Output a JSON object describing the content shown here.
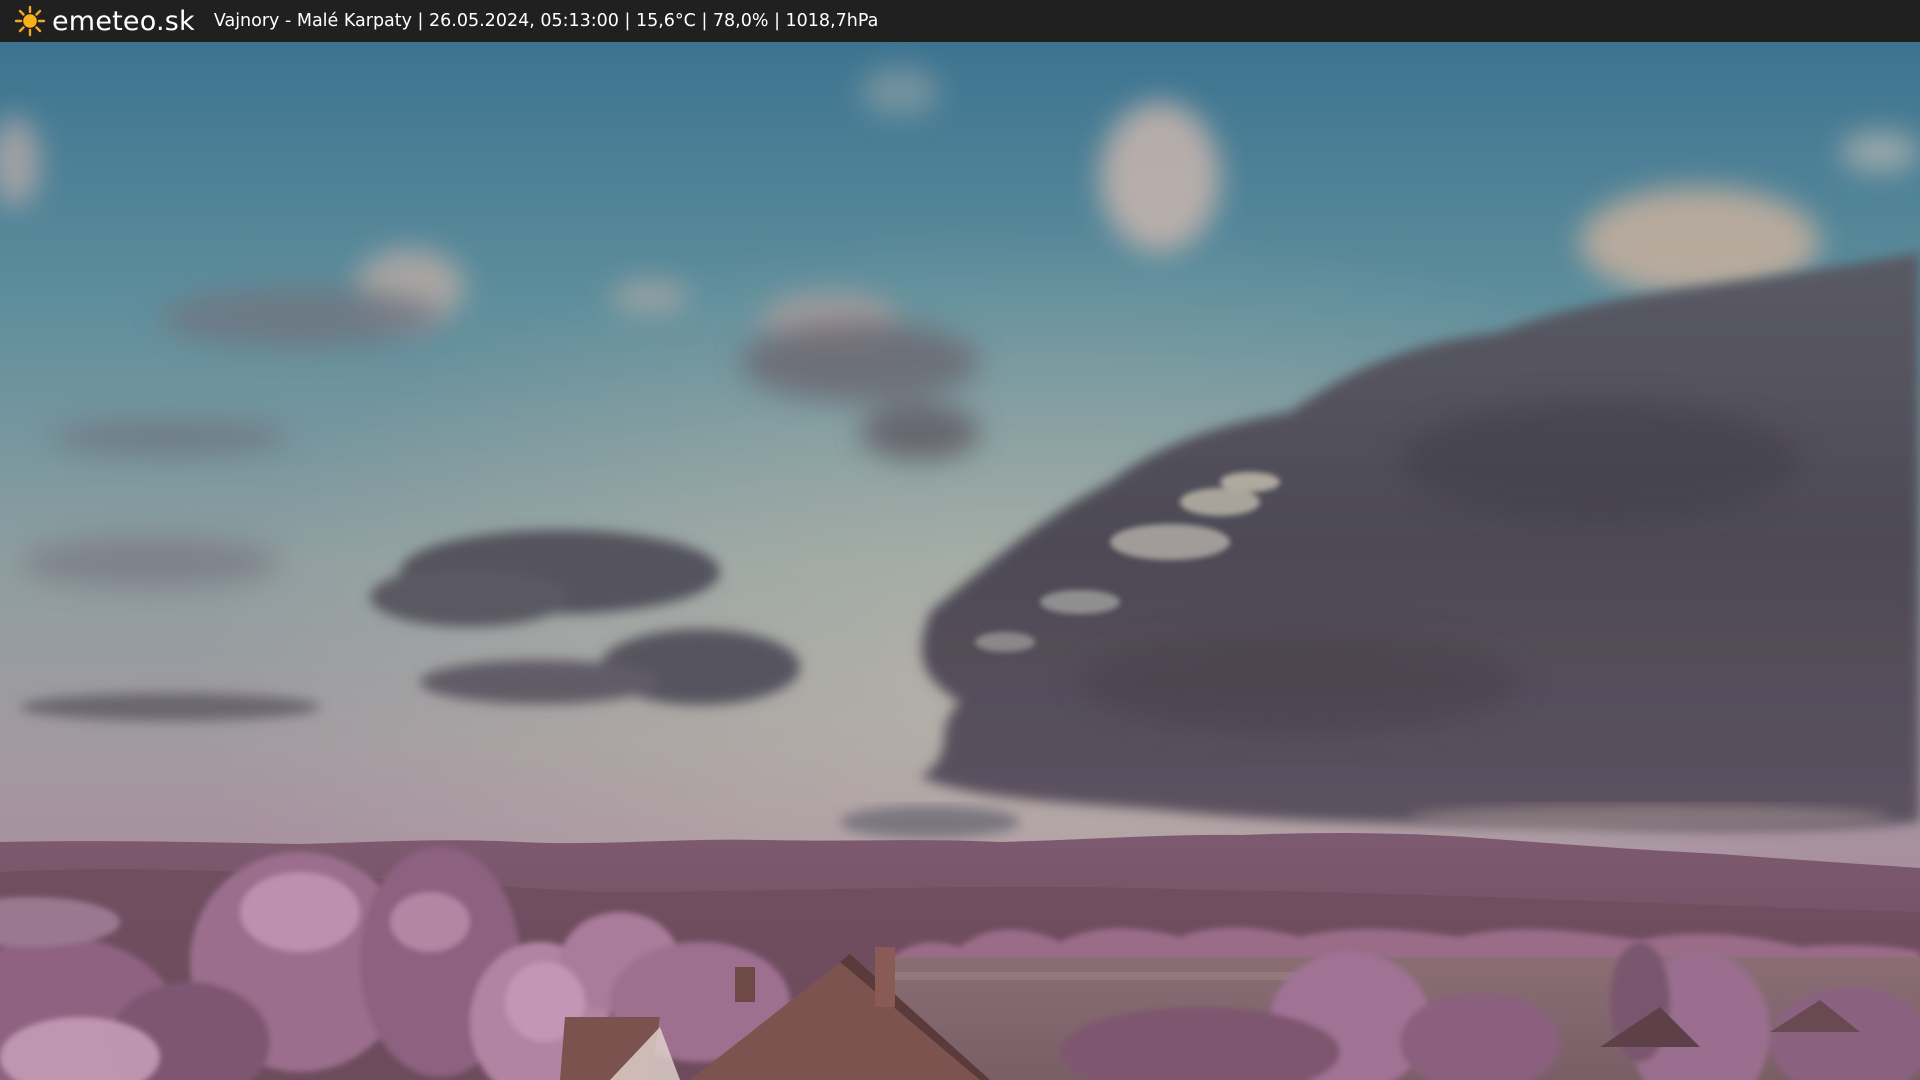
{
  "header": {
    "brand": "emeteo.sk",
    "brand_icon": "sun-icon",
    "station_info": "Vajnory - Malé Karpaty | 26.05.2024, 05:13:00 | 15,6°C | 78,0% | 1018,7hPa"
  },
  "image": {
    "subject": "webcam-view",
    "colors": {
      "sky_top": "#3f7590",
      "sky_mid": "#8f9d9c",
      "sky_horizon": "#b29aa0",
      "storm_cloud": "#545058",
      "hills": "#7a5468",
      "foliage": "#b07e9c",
      "roof": "#7d5350"
    }
  }
}
